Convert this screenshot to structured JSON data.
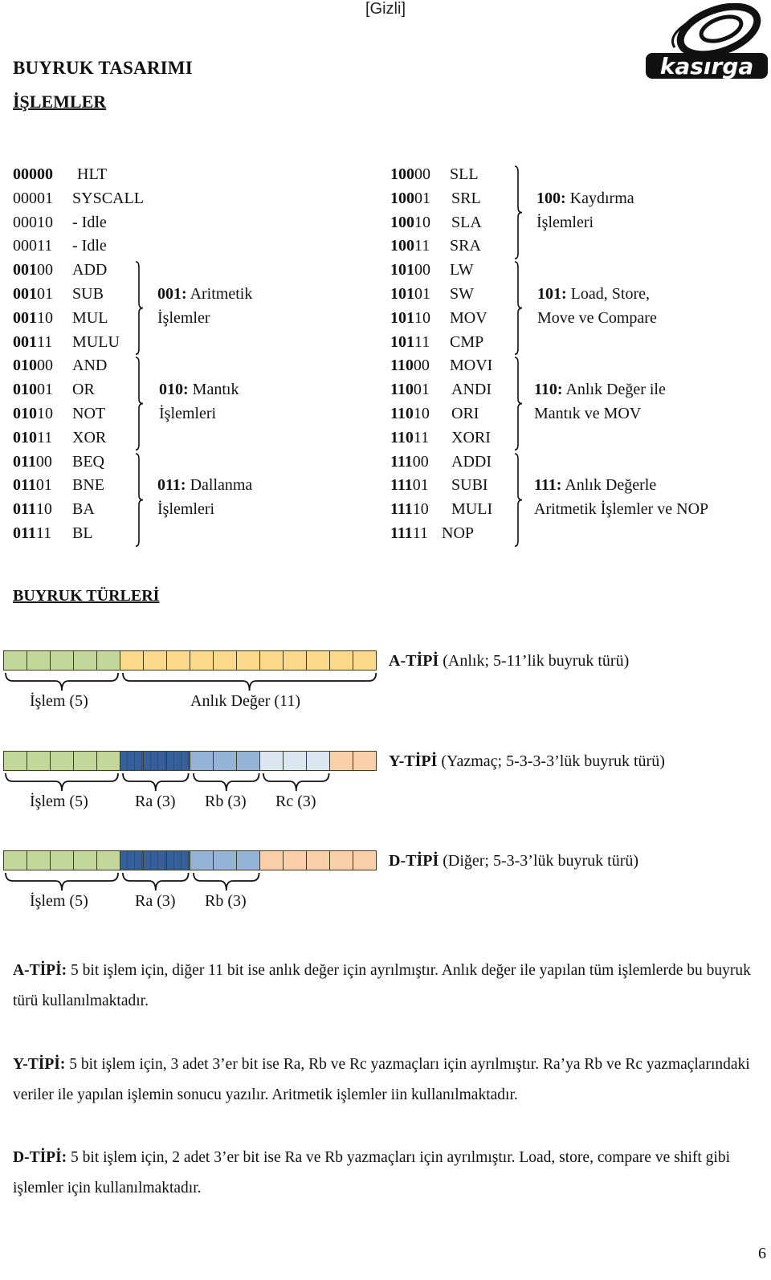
{
  "header": {
    "classification": "[Gizli]",
    "logo_text": "kasırga"
  },
  "title": "BUYRUK TASARIMI",
  "operations_heading": "İŞLEMLER",
  "operations": {
    "left": [
      {
        "bold": "00000",
        "rest": "",
        "mnemonic": "HLT"
      },
      {
        "bold": "",
        "rest": "00001",
        "mnemonic": "SYSCALL"
      },
      {
        "bold": "",
        "rest": "00010",
        "mnemonic": "- Idle"
      },
      {
        "bold": "",
        "rest": "00011",
        "mnemonic": "- Idle"
      },
      {
        "bold": "001",
        "rest": "00",
        "mnemonic": "ADD"
      },
      {
        "bold": "001",
        "rest": "01",
        "mnemonic": "SUB"
      },
      {
        "bold": "001",
        "rest": "10",
        "mnemonic": "MUL"
      },
      {
        "bold": "001",
        "rest": "11",
        "mnemonic": "MULU"
      },
      {
        "bold": "010",
        "rest": "00",
        "mnemonic": "AND"
      },
      {
        "bold": "010",
        "rest": "01",
        "mnemonic": "OR"
      },
      {
        "bold": "010",
        "rest": "10",
        "mnemonic": "NOT"
      },
      {
        "bold": "010",
        "rest": "11",
        "mnemonic": "XOR"
      },
      {
        "bold": "011",
        "rest": "00",
        "mnemonic": "BEQ"
      },
      {
        "bold": "011",
        "rest": "01",
        "mnemonic": "BNE"
      },
      {
        "bold": "011",
        "rest": "10",
        "mnemonic": "BA"
      },
      {
        "bold": "011",
        "rest": "11",
        "mnemonic": "BL"
      }
    ],
    "right": [
      {
        "bold": "100",
        "rest": "00",
        "mnemonic": "SLL"
      },
      {
        "bold": "100",
        "rest": "01",
        "mnemonic": "SRL"
      },
      {
        "bold": "100",
        "rest": "10",
        "mnemonic": "SLA"
      },
      {
        "bold": "100",
        "rest": "11",
        "mnemonic": "SRA"
      },
      {
        "bold": "101",
        "rest": "00",
        "mnemonic": "LW"
      },
      {
        "bold": "101",
        "rest": "01",
        "mnemonic": "SW"
      },
      {
        "bold": "101",
        "rest": "10",
        "mnemonic": "MOV"
      },
      {
        "bold": "101",
        "rest": "11",
        "mnemonic": "CMP"
      },
      {
        "bold": "110",
        "rest": "00",
        "mnemonic": "MOVI"
      },
      {
        "bold": "110",
        "rest": "01",
        "mnemonic": "ANDI"
      },
      {
        "bold": "110",
        "rest": "10",
        "mnemonic": "ORI"
      },
      {
        "bold": "110",
        "rest": "11",
        "mnemonic": "XORI"
      },
      {
        "bold": "111",
        "rest": "00",
        "mnemonic": "ADDI"
      },
      {
        "bold": "111",
        "rest": "01",
        "mnemonic": "SUBI"
      },
      {
        "bold": "111",
        "rest": "10",
        "mnemonic": "MULI"
      },
      {
        "bold": "111",
        "rest": "11",
        "mnemonic": "NOP"
      }
    ],
    "groups": [
      {
        "prefix": "001:",
        "line1": " Aritmetik",
        "line2": "İşlemler"
      },
      {
        "prefix": "010:",
        "line1": " Mantık",
        "line2": "İşlemleri"
      },
      {
        "prefix": "011:",
        "line1": " Dallanma",
        "line2": "İşlemleri"
      },
      {
        "prefix": "100:",
        "line1": " Kaydırma",
        "line2": "İşlemleri"
      },
      {
        "prefix": "101:",
        "line1": " Load, Store,",
        "line2": "Move ve Compare"
      },
      {
        "prefix": "110:",
        "line1": " Anlık Değer ile",
        "line2": "Mantık ve MOV"
      },
      {
        "prefix": "111:",
        "line1": " Anlık Değerle",
        "line2": "Aritmetik İşlemler ve NOP"
      }
    ]
  },
  "types_heading": "BUYRUK TÜRLERİ",
  "colors": {
    "opcode": "#c4d79b",
    "immediate": "#fcd98a",
    "ra": "#36609a",
    "rb": "#95b3d7",
    "rc": "#dce6f1",
    "unused": "#fbcfa9",
    "cell_border": "#3b3b22"
  },
  "instruction_types": [
    {
      "name": "A-TİPİ",
      "desc": " (Anlık; 5-11’lik buyruk türü)",
      "segments": [
        {
          "field": "opcode",
          "bits": 5,
          "label": "İşlem (5)"
        },
        {
          "field": "immediate",
          "bits": 11,
          "label": "Anlık Değer (11)"
        }
      ]
    },
    {
      "name": "Y-TİPİ",
      "desc": " (Yazmaç; 5-3-3-3’lük buyruk türü)",
      "segments": [
        {
          "field": "opcode",
          "bits": 5,
          "label": "İşlem (5)"
        },
        {
          "field": "ra",
          "bits": 3,
          "label": "Ra (3)"
        },
        {
          "field": "rb",
          "bits": 3,
          "label": "Rb (3)"
        },
        {
          "field": "rc",
          "bits": 3,
          "label": "Rc (3)"
        },
        {
          "field": "unused",
          "bits": 2,
          "label": ""
        }
      ]
    },
    {
      "name": "D-TİPİ",
      "desc": " (Diğer; 5-3-3’lük buyruk türü)",
      "segments": [
        {
          "field": "opcode",
          "bits": 5,
          "label": "İşlem (5)"
        },
        {
          "field": "ra",
          "bits": 3,
          "label": "Ra (3)"
        },
        {
          "field": "rb",
          "bits": 3,
          "label": "Rb (3)"
        },
        {
          "field": "unused",
          "bits": 5,
          "label": ""
        }
      ]
    }
  ],
  "descriptions": [
    {
      "term": "A-TİPİ:",
      "text": " 5 bit işlem için, diğer 11 bit ise anlık değer için ayrılmıştır. Anlık değer ile yapılan tüm işlemlerde bu buyruk türü kullanılmaktadır."
    },
    {
      "term": "Y-TİPİ:",
      "text": " 5 bit işlem için, 3 adet 3’er bit ise Ra, Rb ve Rc yazmaçları için ayrılmıştır. Ra’ya Rb ve Rc yazmaçlarındaki veriler ile yapılan işlemin sonucu yazılır. Aritmetik işlemler iin kullanılmaktadır."
    },
    {
      "term": "D-TİPİ:",
      "text": " 5 bit işlem için, 2 adet 3’er bit ise Ra ve Rb yazmaçları için ayrılmıştır. Load, store, compare ve shift gibi işlemler için kullanılmaktadır."
    }
  ],
  "page_number": "6"
}
